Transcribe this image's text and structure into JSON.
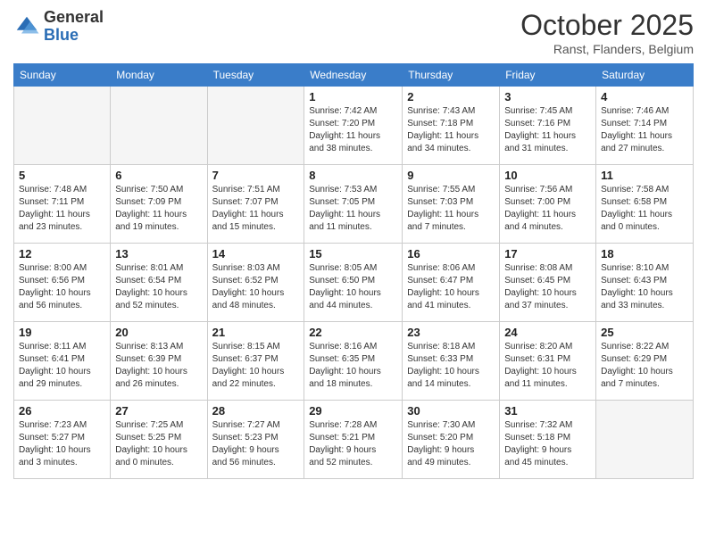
{
  "logo": {
    "general": "General",
    "blue": "Blue"
  },
  "header": {
    "month": "October 2025",
    "location": "Ranst, Flanders, Belgium"
  },
  "weekdays": [
    "Sunday",
    "Monday",
    "Tuesday",
    "Wednesday",
    "Thursday",
    "Friday",
    "Saturday"
  ],
  "weeks": [
    [
      {
        "day": "",
        "info": ""
      },
      {
        "day": "",
        "info": ""
      },
      {
        "day": "",
        "info": ""
      },
      {
        "day": "1",
        "info": "Sunrise: 7:42 AM\nSunset: 7:20 PM\nDaylight: 11 hours\nand 38 minutes."
      },
      {
        "day": "2",
        "info": "Sunrise: 7:43 AM\nSunset: 7:18 PM\nDaylight: 11 hours\nand 34 minutes."
      },
      {
        "day": "3",
        "info": "Sunrise: 7:45 AM\nSunset: 7:16 PM\nDaylight: 11 hours\nand 31 minutes."
      },
      {
        "day": "4",
        "info": "Sunrise: 7:46 AM\nSunset: 7:14 PM\nDaylight: 11 hours\nand 27 minutes."
      }
    ],
    [
      {
        "day": "5",
        "info": "Sunrise: 7:48 AM\nSunset: 7:11 PM\nDaylight: 11 hours\nand 23 minutes."
      },
      {
        "day": "6",
        "info": "Sunrise: 7:50 AM\nSunset: 7:09 PM\nDaylight: 11 hours\nand 19 minutes."
      },
      {
        "day": "7",
        "info": "Sunrise: 7:51 AM\nSunset: 7:07 PM\nDaylight: 11 hours\nand 15 minutes."
      },
      {
        "day": "8",
        "info": "Sunrise: 7:53 AM\nSunset: 7:05 PM\nDaylight: 11 hours\nand 11 minutes."
      },
      {
        "day": "9",
        "info": "Sunrise: 7:55 AM\nSunset: 7:03 PM\nDaylight: 11 hours\nand 7 minutes."
      },
      {
        "day": "10",
        "info": "Sunrise: 7:56 AM\nSunset: 7:00 PM\nDaylight: 11 hours\nand 4 minutes."
      },
      {
        "day": "11",
        "info": "Sunrise: 7:58 AM\nSunset: 6:58 PM\nDaylight: 11 hours\nand 0 minutes."
      }
    ],
    [
      {
        "day": "12",
        "info": "Sunrise: 8:00 AM\nSunset: 6:56 PM\nDaylight: 10 hours\nand 56 minutes."
      },
      {
        "day": "13",
        "info": "Sunrise: 8:01 AM\nSunset: 6:54 PM\nDaylight: 10 hours\nand 52 minutes."
      },
      {
        "day": "14",
        "info": "Sunrise: 8:03 AM\nSunset: 6:52 PM\nDaylight: 10 hours\nand 48 minutes."
      },
      {
        "day": "15",
        "info": "Sunrise: 8:05 AM\nSunset: 6:50 PM\nDaylight: 10 hours\nand 44 minutes."
      },
      {
        "day": "16",
        "info": "Sunrise: 8:06 AM\nSunset: 6:47 PM\nDaylight: 10 hours\nand 41 minutes."
      },
      {
        "day": "17",
        "info": "Sunrise: 8:08 AM\nSunset: 6:45 PM\nDaylight: 10 hours\nand 37 minutes."
      },
      {
        "day": "18",
        "info": "Sunrise: 8:10 AM\nSunset: 6:43 PM\nDaylight: 10 hours\nand 33 minutes."
      }
    ],
    [
      {
        "day": "19",
        "info": "Sunrise: 8:11 AM\nSunset: 6:41 PM\nDaylight: 10 hours\nand 29 minutes."
      },
      {
        "day": "20",
        "info": "Sunrise: 8:13 AM\nSunset: 6:39 PM\nDaylight: 10 hours\nand 26 minutes."
      },
      {
        "day": "21",
        "info": "Sunrise: 8:15 AM\nSunset: 6:37 PM\nDaylight: 10 hours\nand 22 minutes."
      },
      {
        "day": "22",
        "info": "Sunrise: 8:16 AM\nSunset: 6:35 PM\nDaylight: 10 hours\nand 18 minutes."
      },
      {
        "day": "23",
        "info": "Sunrise: 8:18 AM\nSunset: 6:33 PM\nDaylight: 10 hours\nand 14 minutes."
      },
      {
        "day": "24",
        "info": "Sunrise: 8:20 AM\nSunset: 6:31 PM\nDaylight: 10 hours\nand 11 minutes."
      },
      {
        "day": "25",
        "info": "Sunrise: 8:22 AM\nSunset: 6:29 PM\nDaylight: 10 hours\nand 7 minutes."
      }
    ],
    [
      {
        "day": "26",
        "info": "Sunrise: 7:23 AM\nSunset: 5:27 PM\nDaylight: 10 hours\nand 3 minutes."
      },
      {
        "day": "27",
        "info": "Sunrise: 7:25 AM\nSunset: 5:25 PM\nDaylight: 10 hours\nand 0 minutes."
      },
      {
        "day": "28",
        "info": "Sunrise: 7:27 AM\nSunset: 5:23 PM\nDaylight: 9 hours\nand 56 minutes."
      },
      {
        "day": "29",
        "info": "Sunrise: 7:28 AM\nSunset: 5:21 PM\nDaylight: 9 hours\nand 52 minutes."
      },
      {
        "day": "30",
        "info": "Sunrise: 7:30 AM\nSunset: 5:20 PM\nDaylight: 9 hours\nand 49 minutes."
      },
      {
        "day": "31",
        "info": "Sunrise: 7:32 AM\nSunset: 5:18 PM\nDaylight: 9 hours\nand 45 minutes."
      },
      {
        "day": "",
        "info": ""
      }
    ]
  ]
}
